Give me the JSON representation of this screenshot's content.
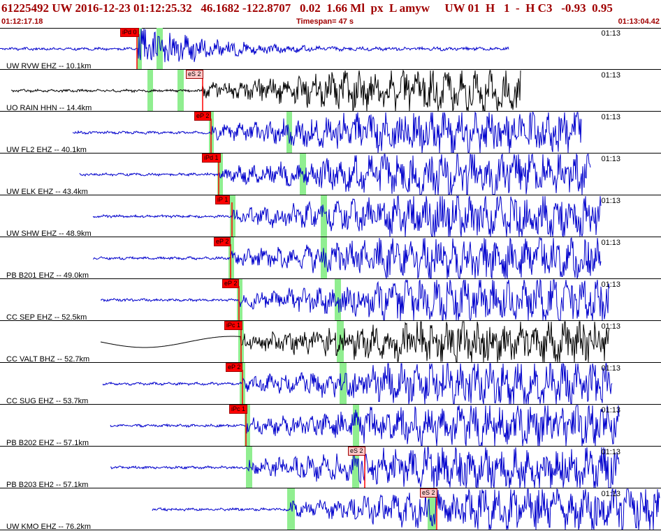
{
  "header": {
    "title": "61225492 UW 2016-12-23 01:12:25.32   46.1682 -122.8707   0.02  1.66 Ml  px  L amyw     UW 01  H   1  -  H C3   -0.93  0.95",
    "time_start": "01:12:17.18",
    "timespan": "Timespan=  47 s",
    "time_end": "01:13:04.42"
  },
  "colors": {
    "trace": "#0000cc",
    "trace_alt": "#000000",
    "phase": "#ff0000",
    "window": "#90ee90",
    "text_header": "#a00000"
  },
  "traces": [
    {
      "label": "UW RVW EHZ -- 10.1km",
      "tick": "01:13",
      "phase": "iPd 0"
    },
    {
      "label": "UO RAIN HHN -- 14.4km",
      "tick": "01:13",
      "phase": "eS 2"
    },
    {
      "label": "UW FL2 EHZ -- 40.1km",
      "tick": "01:13",
      "phase": "eP 2"
    },
    {
      "label": "UW ELK EHZ -- 43.4km",
      "tick": "01:13",
      "phase": "iPd 1"
    },
    {
      "label": "UW SHW EHZ -- 48.9km",
      "tick": "01:13",
      "phase": "iP 1"
    },
    {
      "label": "PB B201 EHZ -- 49.0km",
      "tick": "01:13",
      "phase": "eP 2"
    },
    {
      "label": "CC SEP EHZ -- 52.5km",
      "tick": "01:13",
      "phase": "eP 2"
    },
    {
      "label": "CC VALT BHZ -- 52.7km",
      "tick": "01:13",
      "phase": "iPc 1"
    },
    {
      "label": "CC SUG EHZ -- 53.7km",
      "tick": "01:13",
      "phase": "eP 2"
    },
    {
      "label": "PB B202 EHZ -- 57.1km",
      "tick": "01:13",
      "phase": "iPc 1"
    },
    {
      "label": "PB B203 EH2 -- 57.1km",
      "tick": "01:13",
      "phase": "eS 2"
    },
    {
      "label": "UW KMO EHZ -- 76.2km",
      "tick": "01:13",
      "phase": "eS 2"
    }
  ]
}
